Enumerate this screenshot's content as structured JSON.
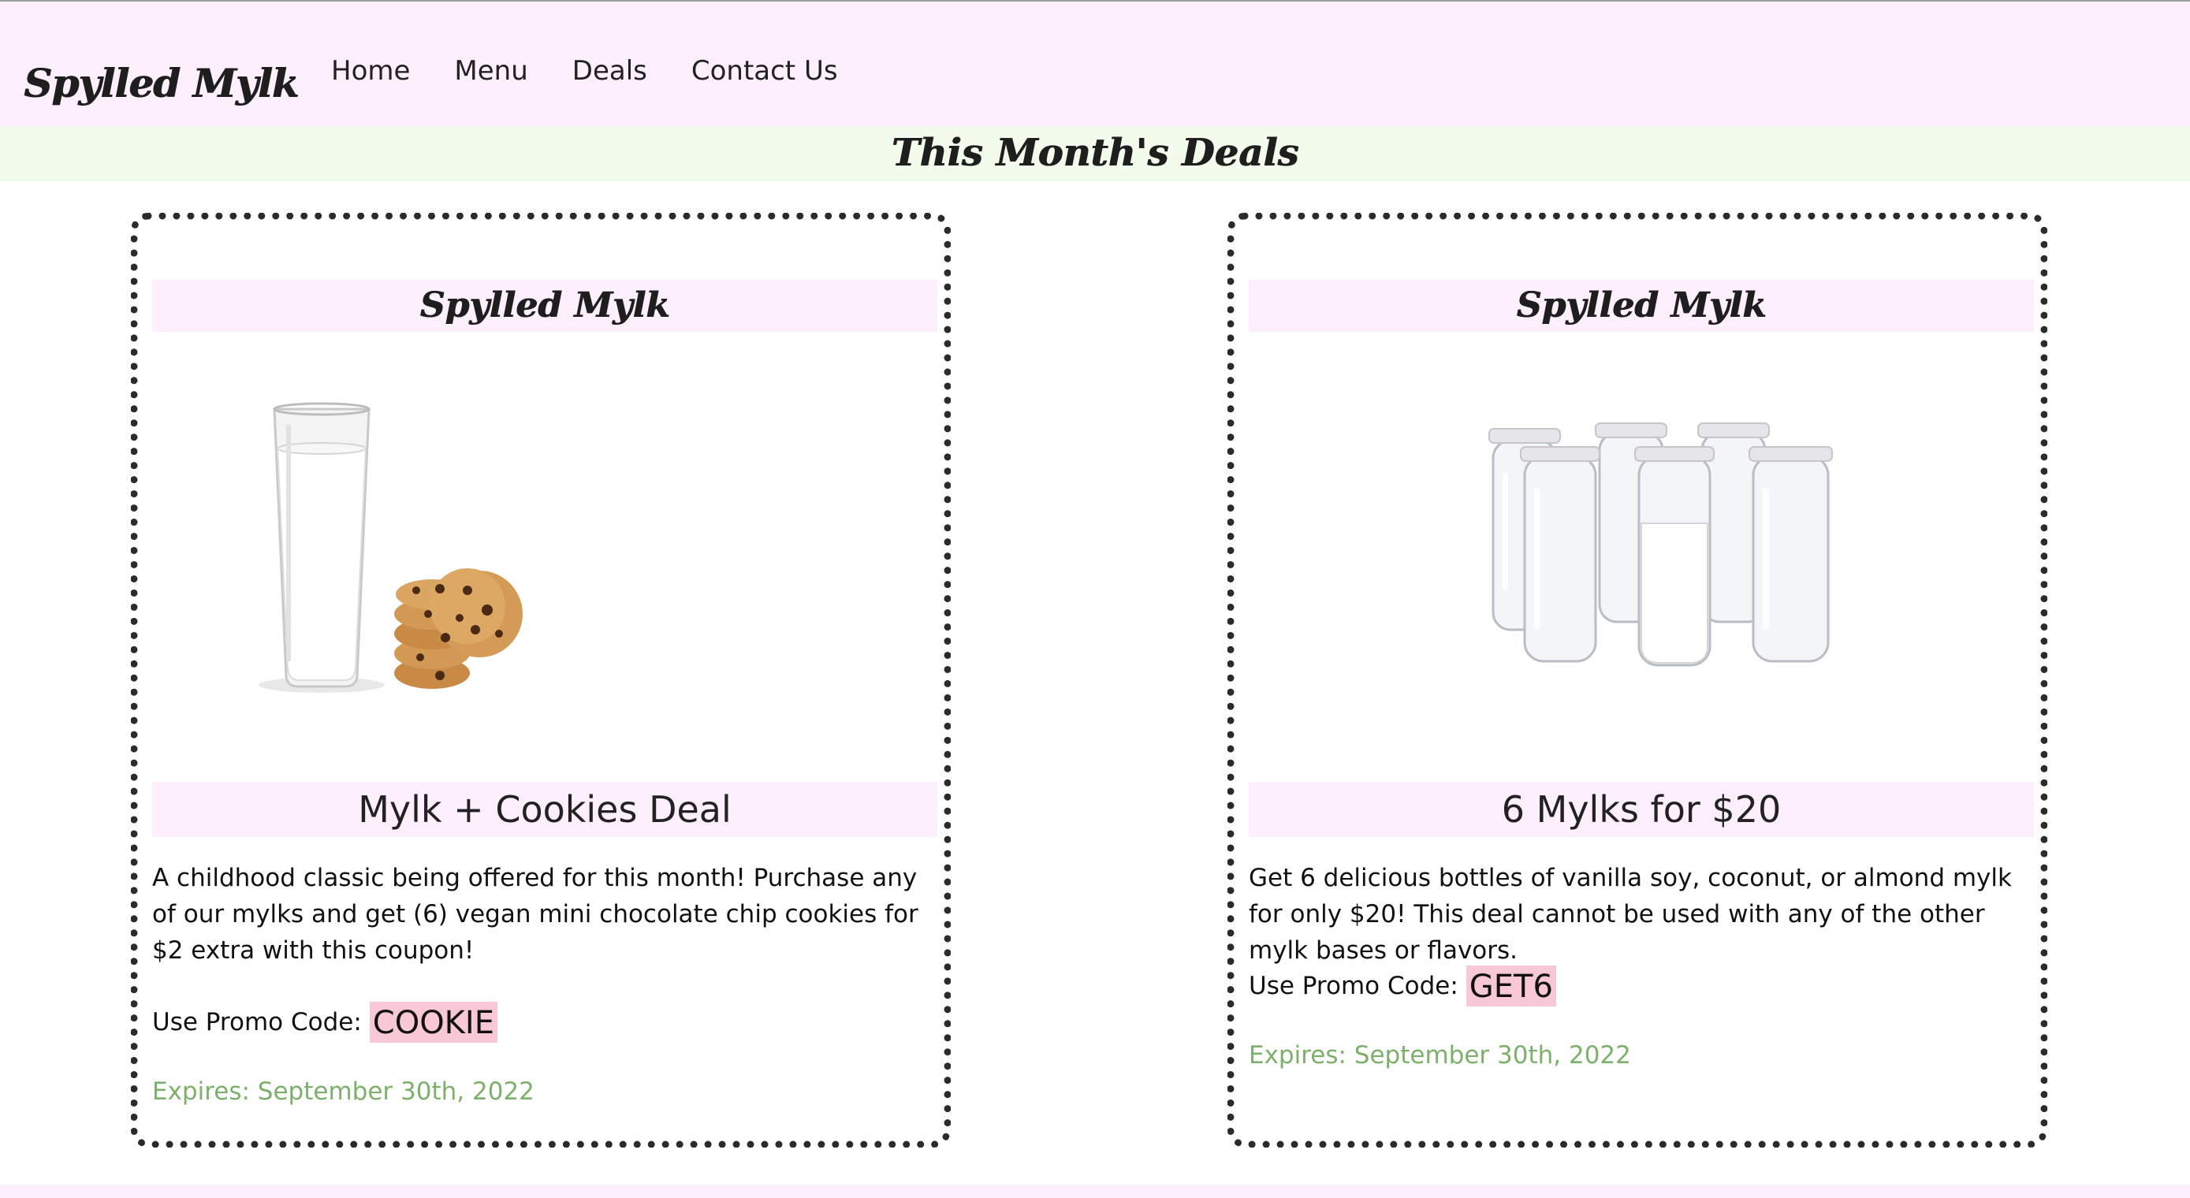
{
  "header": {
    "brand": "Spylled Mylk",
    "nav": [
      "Home",
      "Menu",
      "Deals",
      "Contact Us"
    ]
  },
  "page_title": "This Month's Deals",
  "deals": [
    {
      "brand": "Spylled Mylk",
      "image": "milk-glass-and-cookies-image",
      "title": "Mylk + Cookies Deal",
      "description": "A childhood classic being offered for this month! Purchase any of our mylks and get (6) vegan mini chocolate chip cookies for $2 extra with this coupon!",
      "promo_label": "Use Promo Code:",
      "promo_code": "COOKIE",
      "expires": "Expires: September 30th, 2022"
    },
    {
      "brand": "Spylled Mylk",
      "image": "milk-bottles-image",
      "title": "6 Mylks for $20",
      "description": "Get 6 delicious bottles of vanilla soy, coconut, or almond mylk for only $20! This deal cannot be used with any of the other mylk bases or flavors.",
      "promo_label": "Use Promo Code:",
      "promo_code": "GET6",
      "expires": "Expires: September 30th, 2022"
    }
  ],
  "colors": {
    "header_bg": "#fdeffb",
    "band_bg": "#f3fcec",
    "promo_bg": "#f9c8d6",
    "expires": "#7db16b"
  }
}
